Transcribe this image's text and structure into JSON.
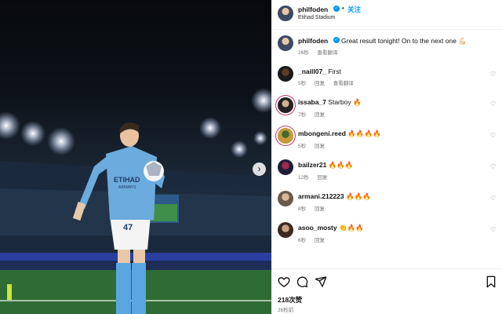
{
  "post": {
    "username": "philfoden",
    "follow_label": "关注",
    "separator": "•",
    "location": "Etihad Stadium",
    "caption": "Great result tonight! On to the next one 💪🏻",
    "caption_age": "26秒",
    "translate_label": "查看翻译",
    "like_count": "218次赞",
    "posted_time": "26秒前"
  },
  "comments": [
    {
      "username": "_naill07_",
      "text": "First",
      "age": "5秒",
      "reply": "回复",
      "translate": "查看翻译"
    },
    {
      "username": "issaba_7",
      "text": "Starboy 🔥",
      "age": "7秒",
      "reply": "回复"
    },
    {
      "username": "mbongeni.reed",
      "text": "🔥🔥🔥🔥",
      "age": "5秒",
      "reply": "回复"
    },
    {
      "username": "bailzer21",
      "text": "🔥🔥🔥",
      "age": "12秒",
      "reply": "回复"
    },
    {
      "username": "armani.212223",
      "text": "🔥🔥🔥",
      "age": "8秒",
      "reply": "回复"
    },
    {
      "username": "asoo_mosty",
      "text": "👏🔥🔥",
      "age": "6秒",
      "reply": "回复"
    }
  ],
  "player": {
    "shirt_sponsor": "ETIHAD",
    "shirt_sub": "AIRWAYS",
    "shorts_number": "47"
  },
  "icons": {
    "verified": "verified-badge-icon",
    "like": "heart-icon",
    "comment": "comment-bubble-icon",
    "share": "paper-plane-icon",
    "save": "bookmark-icon",
    "next": "chevron-right-icon"
  },
  "colors": {
    "accent": "#0095f6",
    "kit": "#6cabdd",
    "pitch": "#2f6b34"
  }
}
